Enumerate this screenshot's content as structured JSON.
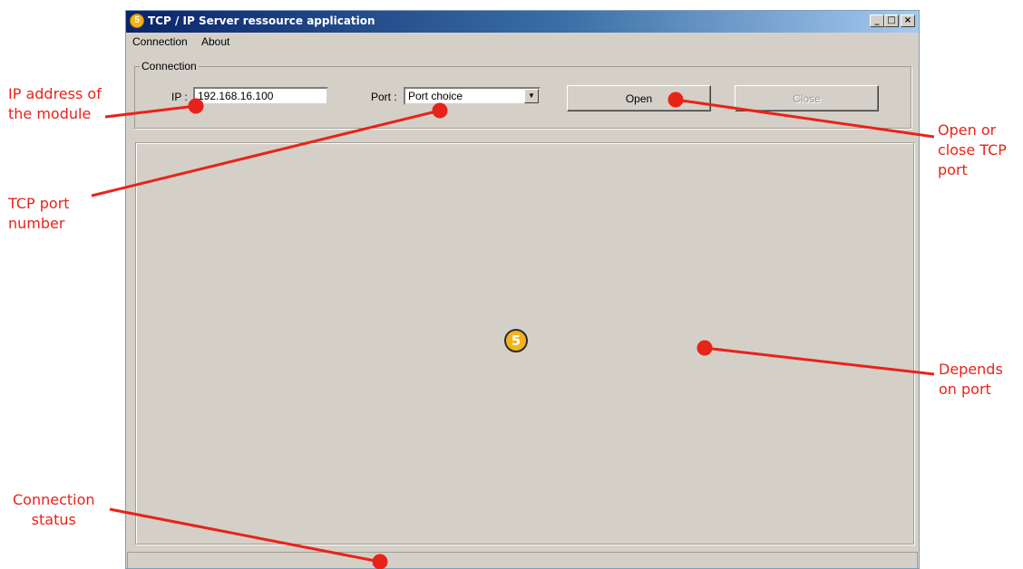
{
  "window": {
    "title": "TCP / IP Server ressource application",
    "title_icon": "5",
    "controls": {
      "minimize": "_",
      "maximize": "□",
      "close": "×"
    }
  },
  "menu": {
    "items": [
      "Connection",
      "About"
    ]
  },
  "connection": {
    "group_label": "Connection",
    "ip_label": "IP :",
    "ip_value": "192.168.16.100",
    "port_label": "Port :",
    "port_selected": "Port choice",
    "open_label": "Open",
    "close_label": "Close"
  },
  "center_logo": "5",
  "annotations": {
    "ip": [
      "IP address of",
      "the module"
    ],
    "tcp_port": [
      "TCP port",
      "number"
    ],
    "open_close": [
      "Open or",
      "close TCP",
      "port"
    ],
    "depends": [
      "Depends",
      "on port"
    ],
    "status": [
      "Connection",
      "status"
    ]
  },
  "colors": {
    "annotation": "#e8231a",
    "window_bg": "#d4d0c8",
    "title_bar": "#0a246a"
  }
}
